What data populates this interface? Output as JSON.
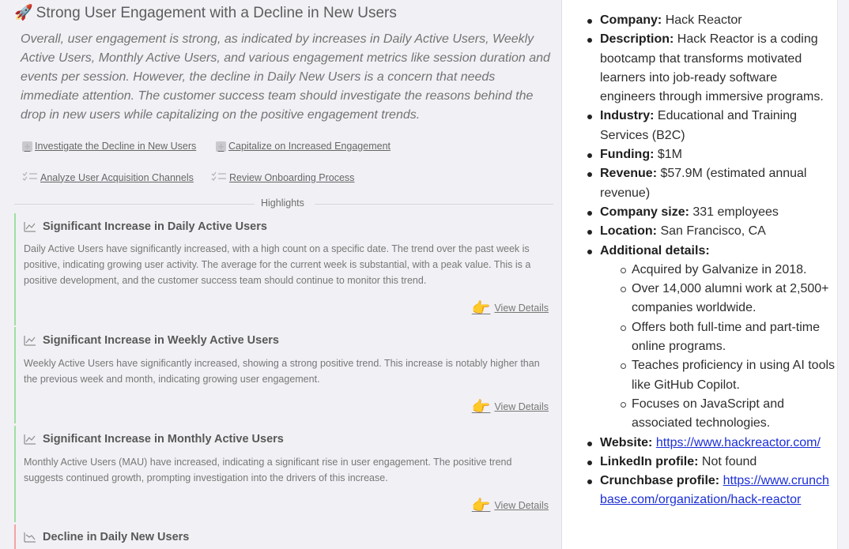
{
  "insight": {
    "emoji": "🚀",
    "title": "Strong User Engagement with a Decline in New Users",
    "summary": "Overall, user engagement is strong, as indicated by increases in Daily Active Users, Weekly Active Users, Monthly Active Users, and various engagement metrics like session duration and events per session. However, the decline in Daily New Users is a concern that needs immediate attention. The customer success team should investigate the reasons behind the drop in new users while capitalizing on the positive engagement trends.",
    "actions": [
      {
        "label": "Investigate the Decline in New Users",
        "icon": "plus-square-icon"
      },
      {
        "label": "Capitalize on Increased Engagement",
        "icon": "plus-square-icon"
      },
      {
        "label": "Analyze User Acquisition Channels",
        "icon": "checklist-icon"
      },
      {
        "label": "Review Onboarding Process",
        "icon": "checklist-icon"
      }
    ],
    "highlights_label": "Highlights",
    "highlights": [
      {
        "title": "Significant Increase in Daily Active Users",
        "body": "Daily Active Users have significantly increased, with a high count on a specific date. The trend over the past week is positive, indicating growing user activity. The average for the current week is substantial, with a peak value. This is a positive development, and the customer success team should continue to monitor this trend.",
        "link": "View Details",
        "status": "positive"
      },
      {
        "title": "Significant Increase in Weekly Active Users",
        "body": "Weekly Active Users have significantly increased, showing a strong positive trend. This increase is notably higher than the previous week and month, indicating growing user engagement.",
        "link": "View Details",
        "status": "positive"
      },
      {
        "title": "Significant Increase in Monthly Active Users",
        "body": "Monthly Active Users (MAU) have increased, indicating a significant rise in user engagement. The positive trend suggests continued growth, prompting investigation into the drivers of this increase.",
        "link": "View Details",
        "status": "positive"
      },
      {
        "title": "Decline in Daily New Users",
        "body": "",
        "link": "",
        "status": "negative"
      }
    ],
    "colors": {
      "positive": "#9fe0a2",
      "negative": "#f2a3a3",
      "link": "#1c2fd6"
    }
  },
  "company": {
    "name_label": "Company:",
    "name": "Hack Reactor",
    "description_label": "Description:",
    "description": "Hack Reactor is a coding bootcamp that transforms motivated learners into job-ready software engineers through immersive programs.",
    "industry_label": "Industry:",
    "industry": "Educational and Training Services (B2C)",
    "funding_label": "Funding:",
    "funding": "$1M",
    "revenue_label": "Revenue:",
    "revenue": "$57.9M (estimated annual revenue)",
    "size_label": "Company size:",
    "size": "331 employees",
    "location_label": "Location:",
    "location": "San Francisco, CA",
    "additional_label": "Additional details:",
    "additional": [
      "Acquired by Galvanize in 2018.",
      "Over 14,000 alumni work at 2,500+ companies worldwide.",
      "Offers both full-time and part-time online programs.",
      "Teaches proficiency in using AI tools like GitHub Copilot.",
      "Focuses on JavaScript and associated technologies."
    ],
    "website_label": "Website:",
    "website": "https://www.hackreactor.com/",
    "linkedin_label": "LinkedIn profile:",
    "linkedin": "Not found",
    "crunchbase_label": "Crunchbase profile:",
    "crunchbase": "https://www.crunchbase.com/organization/hack-reactor"
  }
}
